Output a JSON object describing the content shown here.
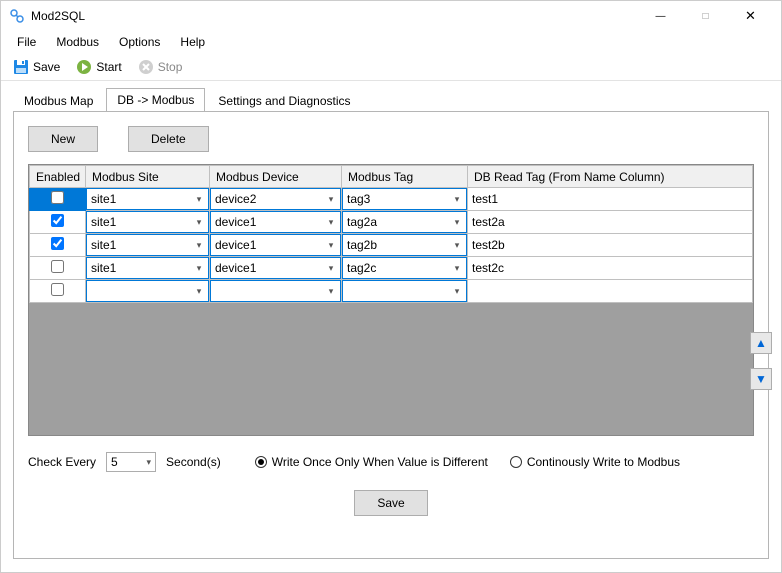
{
  "window": {
    "title": "Mod2SQL"
  },
  "menu": {
    "file": "File",
    "modbus": "Modbus",
    "options": "Options",
    "help": "Help"
  },
  "toolbar": {
    "save": "Save",
    "start": "Start",
    "stop": "Stop"
  },
  "tabs": {
    "map": "Modbus Map",
    "db": "DB -> Modbus",
    "settings": "Settings and Diagnostics"
  },
  "buttons": {
    "new": "New",
    "delete": "Delete",
    "save": "Save"
  },
  "grid": {
    "headers": {
      "enabled": "Enabled",
      "site": "Modbus Site",
      "device": "Modbus Device",
      "tag": "Modbus Tag",
      "db": "DB Read Tag (From Name Column)"
    },
    "rows": [
      {
        "enabled": false,
        "site": "site1",
        "device": "device2",
        "tag": "tag3",
        "db": "test1"
      },
      {
        "enabled": true,
        "site": "site1",
        "device": "device1",
        "tag": "tag2a",
        "db": "test2a"
      },
      {
        "enabled": true,
        "site": "site1",
        "device": "device1",
        "tag": "tag2b",
        "db": "test2b"
      },
      {
        "enabled": false,
        "site": "site1",
        "device": "device1",
        "tag": "tag2c",
        "db": "test2c"
      },
      {
        "enabled": false,
        "site": "",
        "device": "",
        "tag": "",
        "db": ""
      }
    ]
  },
  "bottom": {
    "check_every": "Check Every",
    "check_value": "5",
    "seconds": "Second(s)",
    "radio_once": "Write Once Only When Value is Different",
    "radio_cont": "Continously Write to Modbus",
    "radio_selected": "once"
  }
}
